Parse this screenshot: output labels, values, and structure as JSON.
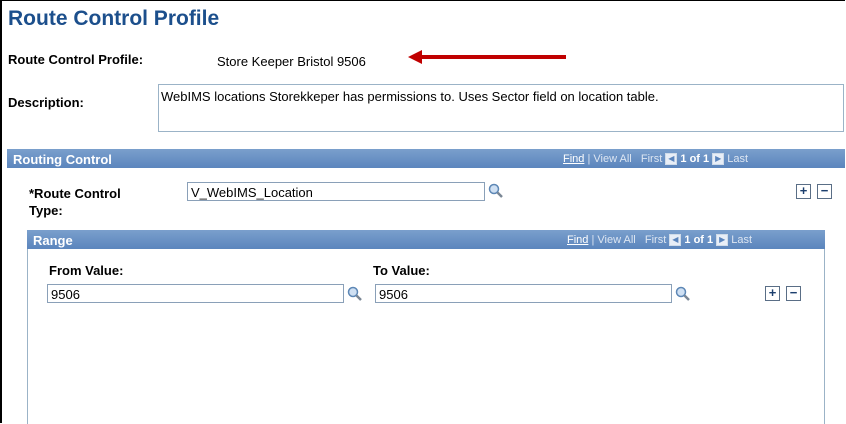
{
  "page": {
    "title": "Route Control Profile",
    "profile_label": "Route Control Profile:",
    "profile_value": "Store Keeper Bristol 9506",
    "description_label": "Description:",
    "description_value": "WebIMS locations Storekkeper has permissions to.  Uses Sector field on location table."
  },
  "routing_control": {
    "header": "Routing Control",
    "nav": {
      "find": "Find",
      "sep": "|",
      "view_all": "View All",
      "first": "First",
      "count": "1 of 1",
      "last": "Last"
    },
    "route_control_label_line1": "*Route Control",
    "route_control_label_line2": "Type:",
    "route_control_value": "V_WebIMS_Location",
    "add": "+",
    "remove": "−"
  },
  "range": {
    "header": "Range",
    "nav": {
      "find": "Find",
      "sep": "|",
      "view_all": "View All",
      "first": "First",
      "count": "1 of 1",
      "last": "Last"
    },
    "from_label": "From Value:",
    "to_label": "To Value:",
    "from_value": "9506",
    "to_value": "9506",
    "add": "+",
    "remove": "−"
  },
  "colors": {
    "title": "#1c4f8c",
    "arrow": "#c00000",
    "bar": "#6b93c6"
  },
  "icons": {
    "lookup": "magnifier-icon",
    "arrow": "red-arrow-icon"
  }
}
